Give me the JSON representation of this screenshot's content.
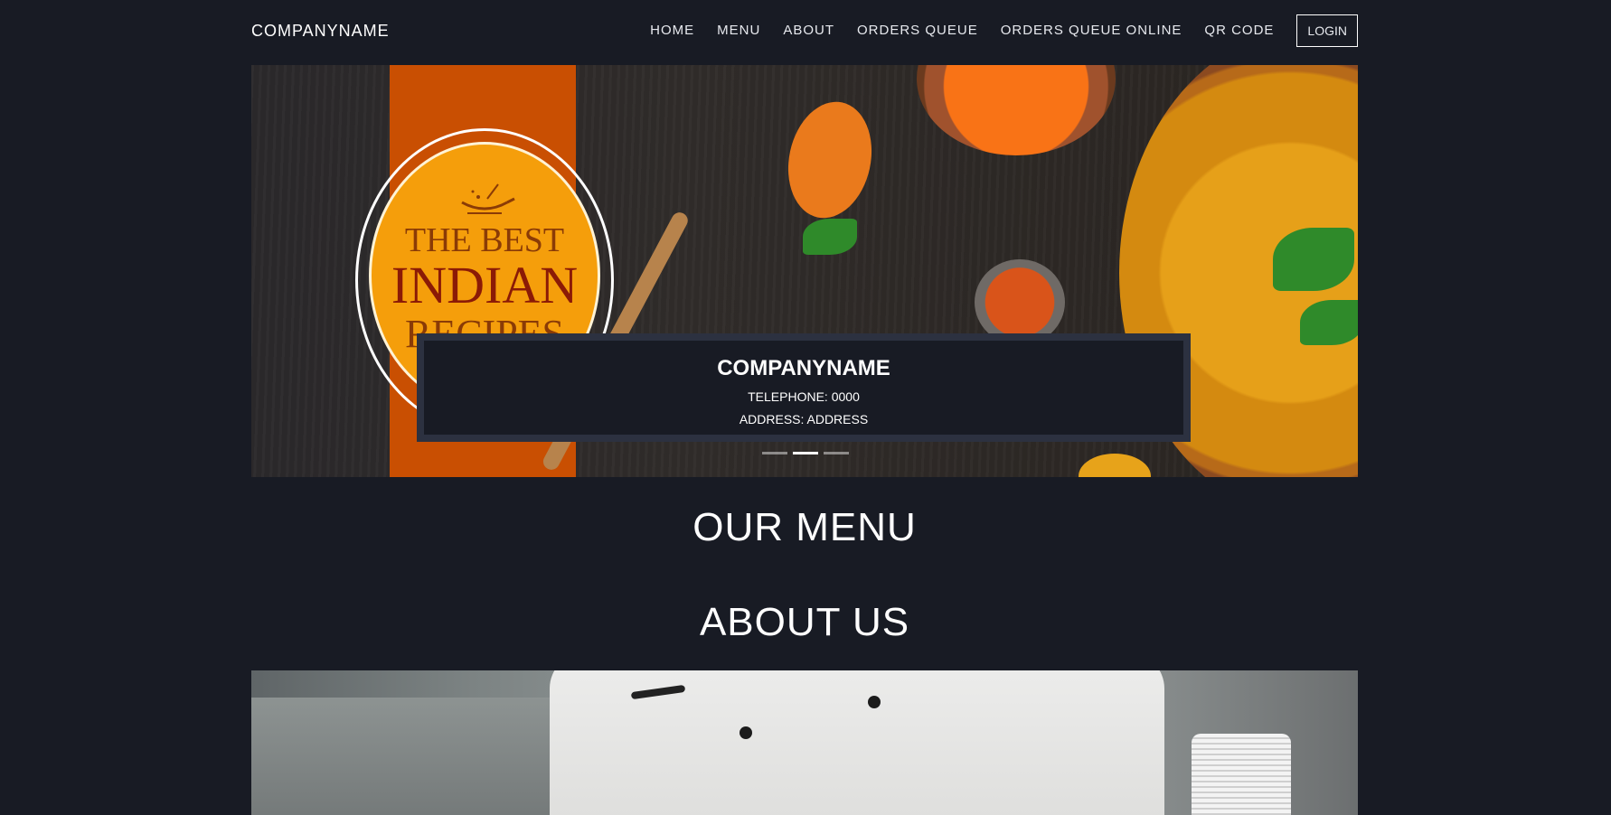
{
  "navbar": {
    "brand": "COMPANYNAME",
    "items": [
      {
        "label": "HOME"
      },
      {
        "label": "MENU"
      },
      {
        "label": "ABOUT"
      },
      {
        "label": "ORDERS QUEUE"
      },
      {
        "label": "ORDERS QUEUE ONLINE"
      },
      {
        "label": "QR CODE"
      }
    ],
    "login_label": "LOGIN"
  },
  "hero": {
    "image_text": {
      "line1": "THE BEST",
      "line2": "INDIAN",
      "line3": "RECIPES"
    },
    "caption": {
      "title": "COMPANYNAME",
      "telephone": "TELEPHONE: 0000",
      "address": "ADDRESS: ADDRESS"
    },
    "indicators": {
      "count": 3,
      "active_index": 1
    }
  },
  "sections": {
    "menu_heading": "OUR MENU",
    "about_heading": "ABOUT US"
  },
  "colors": {
    "background": "#181b24",
    "caption_border": "#2c3140",
    "accent_orange": "#c94f02"
  }
}
